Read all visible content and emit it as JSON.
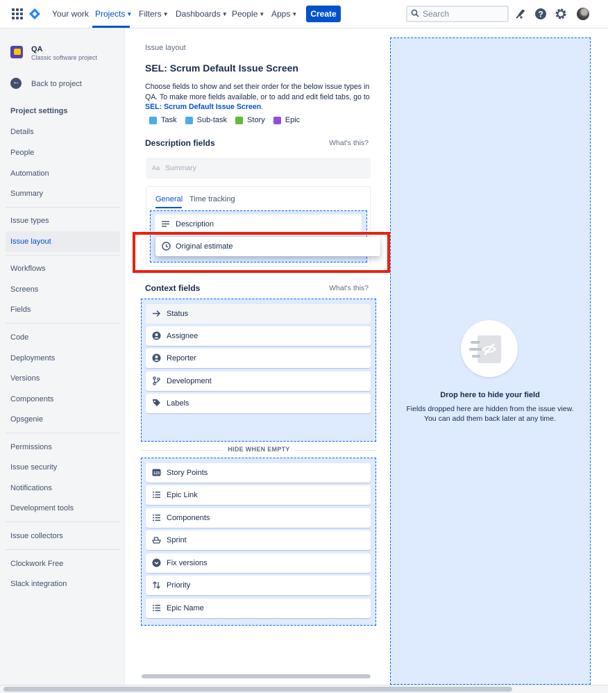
{
  "topnav": {
    "items": [
      {
        "label": "Your work",
        "chevron": false
      },
      {
        "label": "Projects",
        "chevron": true,
        "active": true
      },
      {
        "label": "Filters",
        "chevron": true
      },
      {
        "label": "Dashboards",
        "chevron": true
      },
      {
        "label": "People",
        "chevron": true
      },
      {
        "label": "Apps",
        "chevron": true
      }
    ],
    "create_label": "Create",
    "search_placeholder": "Search",
    "icons": [
      "app-switcher-icon",
      "jira-logo-icon",
      "notifications-icon",
      "help-icon",
      "settings-icon",
      "avatar"
    ]
  },
  "sidebar": {
    "project_name": "QA",
    "project_type": "Classic software project",
    "back_label": "Back to project",
    "section_title": "Project settings",
    "groups": [
      [
        "Details",
        "People",
        "Automation",
        "Summary"
      ],
      [
        "Issue types",
        "Issue layout"
      ],
      [
        "Workflows",
        "Screens",
        "Fields"
      ],
      [
        "Code",
        "Deployments",
        "Versions",
        "Components",
        "Opsgenie"
      ],
      [
        "Permissions",
        "Issue security",
        "Notifications",
        "Development tools"
      ],
      [
        "Issue collectors"
      ],
      [
        "Clockwork Free",
        "Slack integration"
      ]
    ],
    "selected": "Issue layout"
  },
  "main": {
    "breadcrumb": "Issue layout",
    "title": "SEL: Scrum Default Issue Screen",
    "description_pre": "Choose fields to show and set their order for the below issue types in QA. To make more fields available, or to add and edit field tabs, go to",
    "description_link": "SEL: Scrum Default Issue Screen",
    "description_post": ".",
    "issue_types": [
      {
        "label": "Task",
        "color": "#4bade8"
      },
      {
        "label": "Sub-task",
        "color": "#4bade8"
      },
      {
        "label": "Story",
        "color": "#63ba3c"
      },
      {
        "label": "Epic",
        "color": "#904ee2"
      }
    ],
    "description_fields": {
      "title": "Description fields",
      "whats_this": "What's this?",
      "summary_label": "Summary",
      "summary_icon_text": "Aa",
      "tabs": [
        "General",
        "Time tracking"
      ],
      "fields": [
        "Description"
      ],
      "dragging_field": "Original estimate"
    },
    "context_fields": {
      "title": "Context fields",
      "whats_this": "What's this?",
      "fields": [
        "Status",
        "Assignee",
        "Reporter",
        "Development",
        "Labels"
      ],
      "hide_when_empty_label": "HIDE WHEN EMPTY",
      "hidden_when_empty_fields": [
        "Story Points",
        "Epic Link",
        "Components",
        "Sprint",
        "Fix versions",
        "Priority",
        "Epic Name"
      ]
    }
  },
  "hide_zone": {
    "title": "Drop here to hide your field",
    "line1": "Fields dropped here are hidden from the issue view.",
    "line2": "You can add them back later at any time."
  }
}
